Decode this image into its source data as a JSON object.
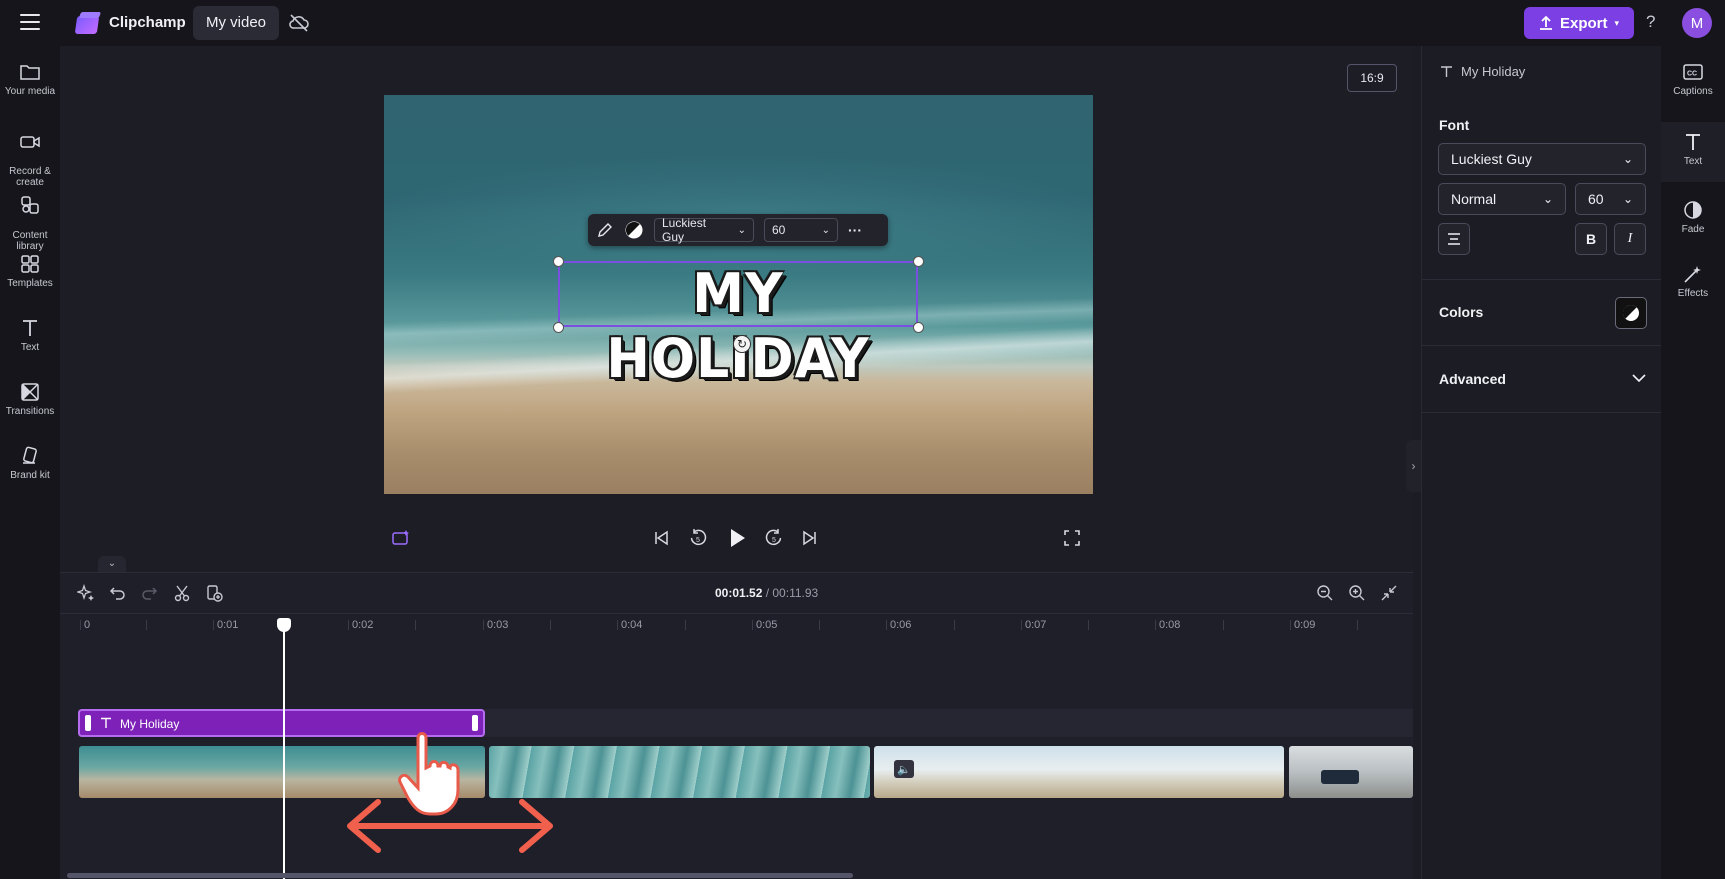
{
  "topbar": {
    "app_name": "Clipchamp",
    "project_name": "My video",
    "export_label": "Export",
    "help_label": "?",
    "avatar_initial": "M",
    "accent_color": "#7b3fe4"
  },
  "leftnav": {
    "items": [
      {
        "label": "Your media",
        "icon": "folder-icon"
      },
      {
        "label": "Record &\ncreate",
        "icon": "camera-icon"
      },
      {
        "label": "Content\nlibrary",
        "icon": "library-icon"
      },
      {
        "label": "Templates",
        "icon": "templates-icon"
      },
      {
        "label": "Text",
        "icon": "text-icon"
      },
      {
        "label": "Transitions",
        "icon": "transitions-icon"
      },
      {
        "label": "Brand kit",
        "icon": "brand-icon"
      }
    ]
  },
  "preview": {
    "aspect_ratio": "16:9",
    "title_text": "MY HOLIDAY",
    "toolbar": {
      "font": "Luckiest Guy",
      "size": "60",
      "more": "···"
    }
  },
  "timeline": {
    "current_time": "00:01.52",
    "total_time": "/ 00:11.93",
    "ticks": [
      "0",
      "0:01",
      "0:02",
      "0:03",
      "0:04",
      "0:05",
      "0:06",
      "0:07",
      "0:08",
      "0:09"
    ],
    "text_clip_label": "My Holiday"
  },
  "properties": {
    "header": "My Holiday",
    "font_section": "Font",
    "font_family": "Luckiest Guy",
    "font_style": "Normal",
    "font_size": "60",
    "bold": "B",
    "italic": "I",
    "colors_section": "Colors",
    "advanced_section": "Advanced"
  },
  "rail": {
    "items": [
      {
        "label": "Captions",
        "icon": "captions-icon"
      },
      {
        "label": "Text",
        "icon": "text-icon"
      },
      {
        "label": "Fade",
        "icon": "fade-icon"
      },
      {
        "label": "Effects",
        "icon": "effects-icon"
      }
    ]
  }
}
